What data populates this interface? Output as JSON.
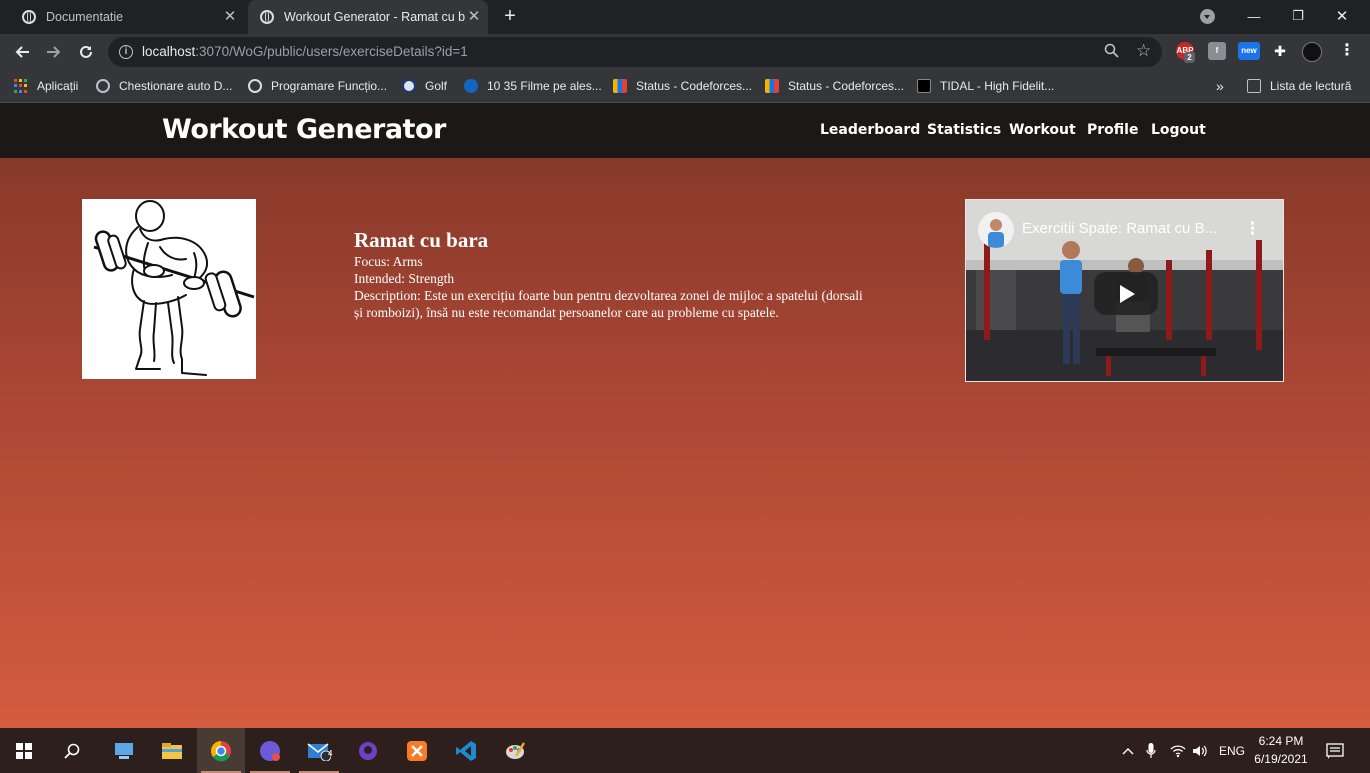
{
  "browser": {
    "tabs": [
      {
        "title": "Documentatie",
        "active": false
      },
      {
        "title": "Workout Generator - Ramat cu b",
        "active": true
      }
    ],
    "new_tab": "+",
    "window_controls": {
      "minimize": "—",
      "restore": "❐",
      "close": "✕"
    },
    "url": {
      "host": "localhost",
      "rest": ":3070/WoG/public/users/exerciseDetails?id=1"
    },
    "extensions": {
      "abp_badge": "2",
      "new_label": "new"
    },
    "bookmarks": [
      {
        "label": "Aplicații",
        "icon": "apps-grid-icon"
      },
      {
        "label": "Chestionare auto D...",
        "icon": "steering-wheel-icon"
      },
      {
        "label": "Programare Funcțio...",
        "icon": "globe-icon"
      },
      {
        "label": "Golf",
        "icon": "vw-icon"
      },
      {
        "label": "10 35 Filme pe ales...",
        "icon": "play-icon"
      },
      {
        "label": "Status - Codeforces...",
        "icon": "codeforces-icon"
      },
      {
        "label": "Status - Codeforces...",
        "icon": "codeforces-icon"
      },
      {
        "label": "TIDAL - High Fidelit...",
        "icon": "tidal-icon"
      }
    ],
    "more_bookmarks": "»",
    "reading_list": "Lista de lectură"
  },
  "site": {
    "brand": "Workout Generator",
    "nav": [
      "Leaderboard",
      "Statistics",
      "Workout",
      "Profile",
      "Logout"
    ]
  },
  "exercise": {
    "title": "Ramat cu bara",
    "focus": "Focus: Arms",
    "intended": "Intended: Strength",
    "description": "Description: Este un exercițiu foarte bun pentru dezvoltarea zonei de mijloc a spatelui (dorsali și romboizi), însă nu este recomandat persoanelor care au probleme cu spatele."
  },
  "video": {
    "title": "Exercitii Spate: Ramat cu B...",
    "more": "⋮"
  },
  "taskbar": {
    "mail_badge": "4",
    "language": "ENG",
    "time": "6:24 PM",
    "date": "6/19/2021"
  },
  "colors": {
    "header": "#1b1817",
    "page_top": "#803628",
    "page_bottom": "#d45c3e"
  }
}
